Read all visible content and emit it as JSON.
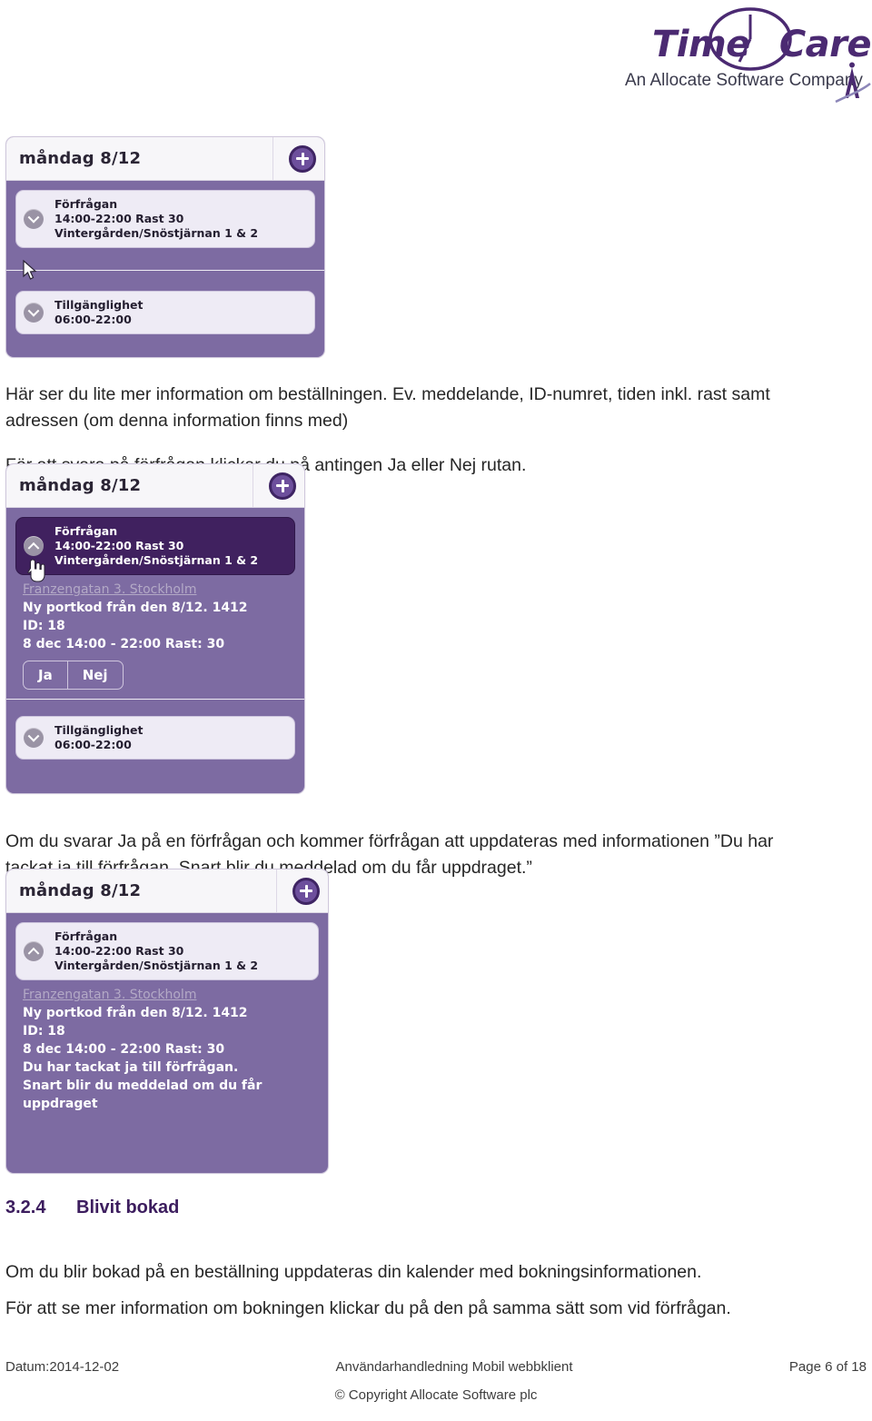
{
  "logo": {
    "brand_part1": "Time",
    "brand_part2": "Care",
    "tagline": "An Allocate Software Company",
    "icon_clock": "clock-icon",
    "icon_allocate": "allocate-a-mark-icon",
    "color_purple": "#4b2a72"
  },
  "screenshot1": {
    "day_label": "måndag 8/12",
    "add_button_label": "+",
    "items": [
      {
        "title": "Förfrågan",
        "line2": "14:00-22:00 Rast 30",
        "line3": "Vintergården/Snöstjärnan 1 & 2",
        "chevron": "chevron-down-icon"
      },
      {
        "title": "Tillgänglighet",
        "line2": "06:00-22:00",
        "chevron": "chevron-down-icon"
      }
    ]
  },
  "paragraph1": "Här ser du lite mer information om beställningen. Ev. meddelande, ID-numret, tiden inkl. rast samt adressen (om denna information finns med)",
  "paragraph2": "För att svara på förfrågan klickar du på antingen Ja eller Nej rutan.",
  "screenshot2": {
    "day_label": "måndag 8/12",
    "add_button_label": "+",
    "request": {
      "title": "Förfrågan",
      "line2": "14:00-22:00 Rast 30",
      "line3": "Vintergården/Snöstjärnan 1 & 2",
      "chevron": "chevron-up-icon"
    },
    "detail": {
      "address": "Franzengatan 3. Stockholm",
      "message": "Ny portkod från den 8/12. 1412",
      "id": "ID: 18",
      "time": "8 dec 14:00 - 22:00 Rast: 30"
    },
    "buttons": {
      "yes": "Ja",
      "no": "Nej"
    },
    "availability": {
      "title": "Tillgänglighet",
      "line2": "06:00-22:00",
      "chevron": "chevron-down-icon"
    }
  },
  "paragraph3": "Om du svarar Ja på en förfrågan och kommer förfrågan att uppdateras med informationen ”Du har tackat ja till förfrågan. Snart blir du meddelad om du får uppdraget.”",
  "screenshot3": {
    "day_label": "måndag 8/12",
    "add_button_label": "+",
    "request": {
      "title": "Förfrågan",
      "line2": "14:00-22:00 Rast 30",
      "line3": "Vintergården/Snöstjärnan 1 & 2",
      "chevron": "chevron-up-icon"
    },
    "detail": {
      "address": "Franzengatan 3. Stockholm",
      "message": "Ny portkod från den 8/12. 1412",
      "id": "ID: 18",
      "time": "8 dec 14:00 - 22:00 Rast: 30",
      "status": "Du har tackat ja till förfrågan. Snart blir du meddelad om du får uppdraget"
    }
  },
  "section": {
    "number": "3.2.4",
    "title": "Blivit bokad",
    "color": "#3c1d5e"
  },
  "paragraph4": "Om du blir bokad på en beställning uppdateras din kalender med bokningsinformationen.",
  "paragraph5": "För att se mer information om bokningen klickar du på den på samma sätt som vid förfrågan.",
  "footer": {
    "date": "Datum:2014-12-02",
    "title": "Användarhandledning Mobil webbklient",
    "page": "Page 6 of 18",
    "copyright": "© Copyright Allocate Software plc"
  }
}
